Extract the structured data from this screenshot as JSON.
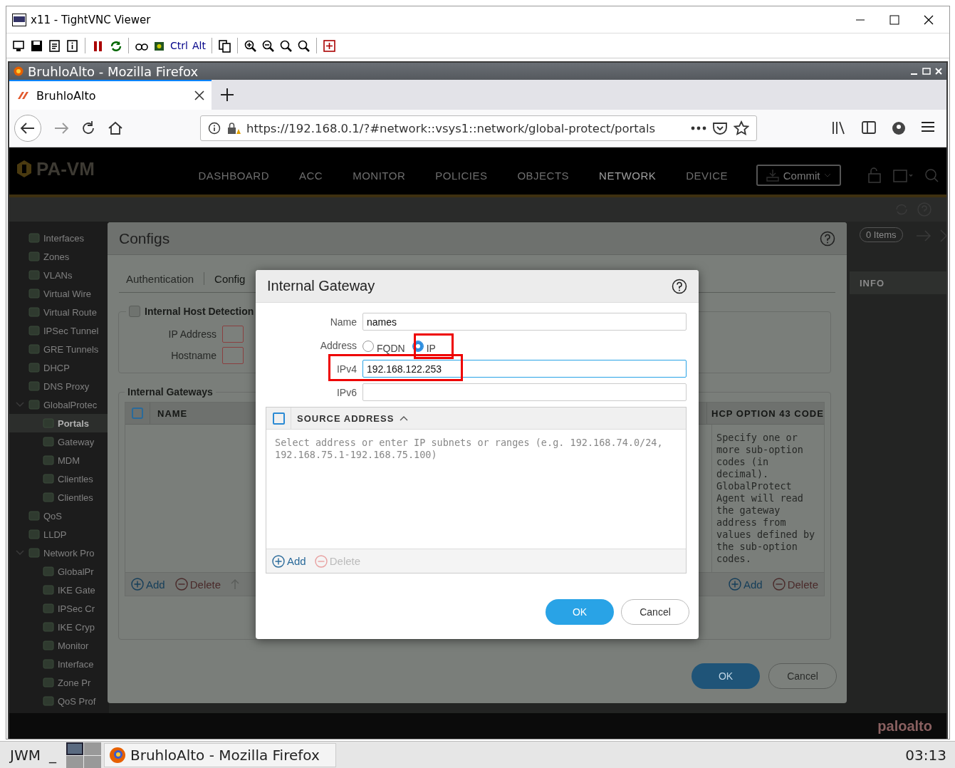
{
  "vnc": {
    "title": "x11 - TightVNC Viewer",
    "keys": [
      "Ctrl",
      "Alt"
    ]
  },
  "firefox": {
    "title": "BruhloAlto - Mozilla Firefox",
    "tabs": [
      {
        "label": "BruhloAlto",
        "selected": true
      }
    ],
    "url": "https://192.168.0.1/?#network::vsys1::network/global-protect/portals"
  },
  "app": {
    "logo": "PA-VM",
    "nav": [
      {
        "label": "DASHBOARD",
        "selected": false
      },
      {
        "label": "ACC",
        "selected": false
      },
      {
        "label": "MONITOR",
        "selected": false
      },
      {
        "label": "POLICIES",
        "selected": false
      },
      {
        "label": "OBJECTS",
        "selected": false
      },
      {
        "label": "NETWORK",
        "selected": true
      },
      {
        "label": "DEVICE",
        "selected": false
      }
    ],
    "commit": "Commit",
    "sidebar": [
      {
        "label": "Interfaces",
        "selected": false
      },
      {
        "label": "Zones",
        "selected": false
      },
      {
        "label": "VLANs",
        "selected": false
      },
      {
        "label": "Virtual Wire",
        "selected": false
      },
      {
        "label": "Virtual Route",
        "selected": false
      },
      {
        "label": "IPSec Tunnel",
        "selected": false
      },
      {
        "label": "GRE Tunnels",
        "selected": false
      },
      {
        "label": "DHCP",
        "selected": false
      },
      {
        "label": "DNS Proxy",
        "selected": false
      },
      {
        "label": "GlobalProtec",
        "selected": false,
        "expanded": true,
        "children": [
          {
            "label": "Portals",
            "selected": true
          },
          {
            "label": "Gateway",
            "selected": false
          },
          {
            "label": "MDM",
            "selected": false
          },
          {
            "label": "Clientles",
            "selected": false
          },
          {
            "label": "Clientles",
            "selected": false
          }
        ]
      },
      {
        "label": "QoS",
        "selected": false
      },
      {
        "label": "LLDP",
        "selected": false
      },
      {
        "label": "Network Pro",
        "selected": false,
        "expanded": true,
        "children": [
          {
            "label": "GlobalPr",
            "selected": false
          },
          {
            "label": "IKE Gate",
            "selected": false
          },
          {
            "label": "IPSec Cr",
            "selected": false
          },
          {
            "label": "IKE Cryp",
            "selected": false
          },
          {
            "label": "Monitor",
            "selected": false
          },
          {
            "label": "Interface",
            "selected": false
          },
          {
            "label": "Zone Pr",
            "selected": false
          },
          {
            "label": "QoS Prof",
            "selected": false
          }
        ]
      }
    ],
    "items_badge": "0 Items",
    "info_column": "INFO",
    "brand": "paloalto"
  },
  "configs": {
    "title": "Configs",
    "tabs": [
      {
        "label": "Authentication",
        "selected": false
      },
      {
        "label": "Config",
        "selected": true
      }
    ],
    "host_detection": {
      "label": "Internal Host Detection",
      "checked": false,
      "fields": [
        {
          "label": "IP Address"
        },
        {
          "label": "Hostname"
        }
      ]
    },
    "gateways": {
      "legend": "Internal Gateways",
      "select_all": {
        "checked": false
      },
      "columns": [
        "NAME",
        "HCP OPTION 43 CODE"
      ],
      "hint": "Specify one or more sub-option codes (in decimal). GlobalProtect Agent will read the gateway address from values defined by the sub-option codes.",
      "actions": [
        {
          "label": "Add",
          "disabled": false
        },
        {
          "label": "Delete",
          "disabled": true
        }
      ],
      "right_actions": [
        {
          "label": "Add",
          "disabled": false
        },
        {
          "label": "Delete",
          "disabled": true
        }
      ]
    },
    "buttons": [
      "OK",
      "Cancel"
    ]
  },
  "gateway": {
    "title": "Internal Gateway",
    "name_label": "Name",
    "name": "names",
    "address_label": "Address",
    "address_options": [
      {
        "label": "FQDN",
        "selected": false
      },
      {
        "label": "IP",
        "selected": true
      }
    ],
    "ipv4_label": "IPv4",
    "ipv4": "192.168.122.253",
    "ipv6_label": "IPv6",
    "source": {
      "select_all": {
        "checked": false
      },
      "column": "SOURCE ADDRESS",
      "placeholder": "Select address or enter IP subnets or ranges (e.g. 192.168.74.0/24, 192.168.75.1-192.168.75.100)",
      "actions": [
        {
          "label": "Add",
          "disabled": false
        },
        {
          "label": "Delete",
          "disabled": true
        }
      ]
    },
    "buttons": [
      "OK",
      "Cancel"
    ]
  },
  "taskbar": {
    "menu": "JWM",
    "minimize": "_",
    "task": "BruhloAlto - Mozilla Firefox",
    "clock": "03:13"
  }
}
